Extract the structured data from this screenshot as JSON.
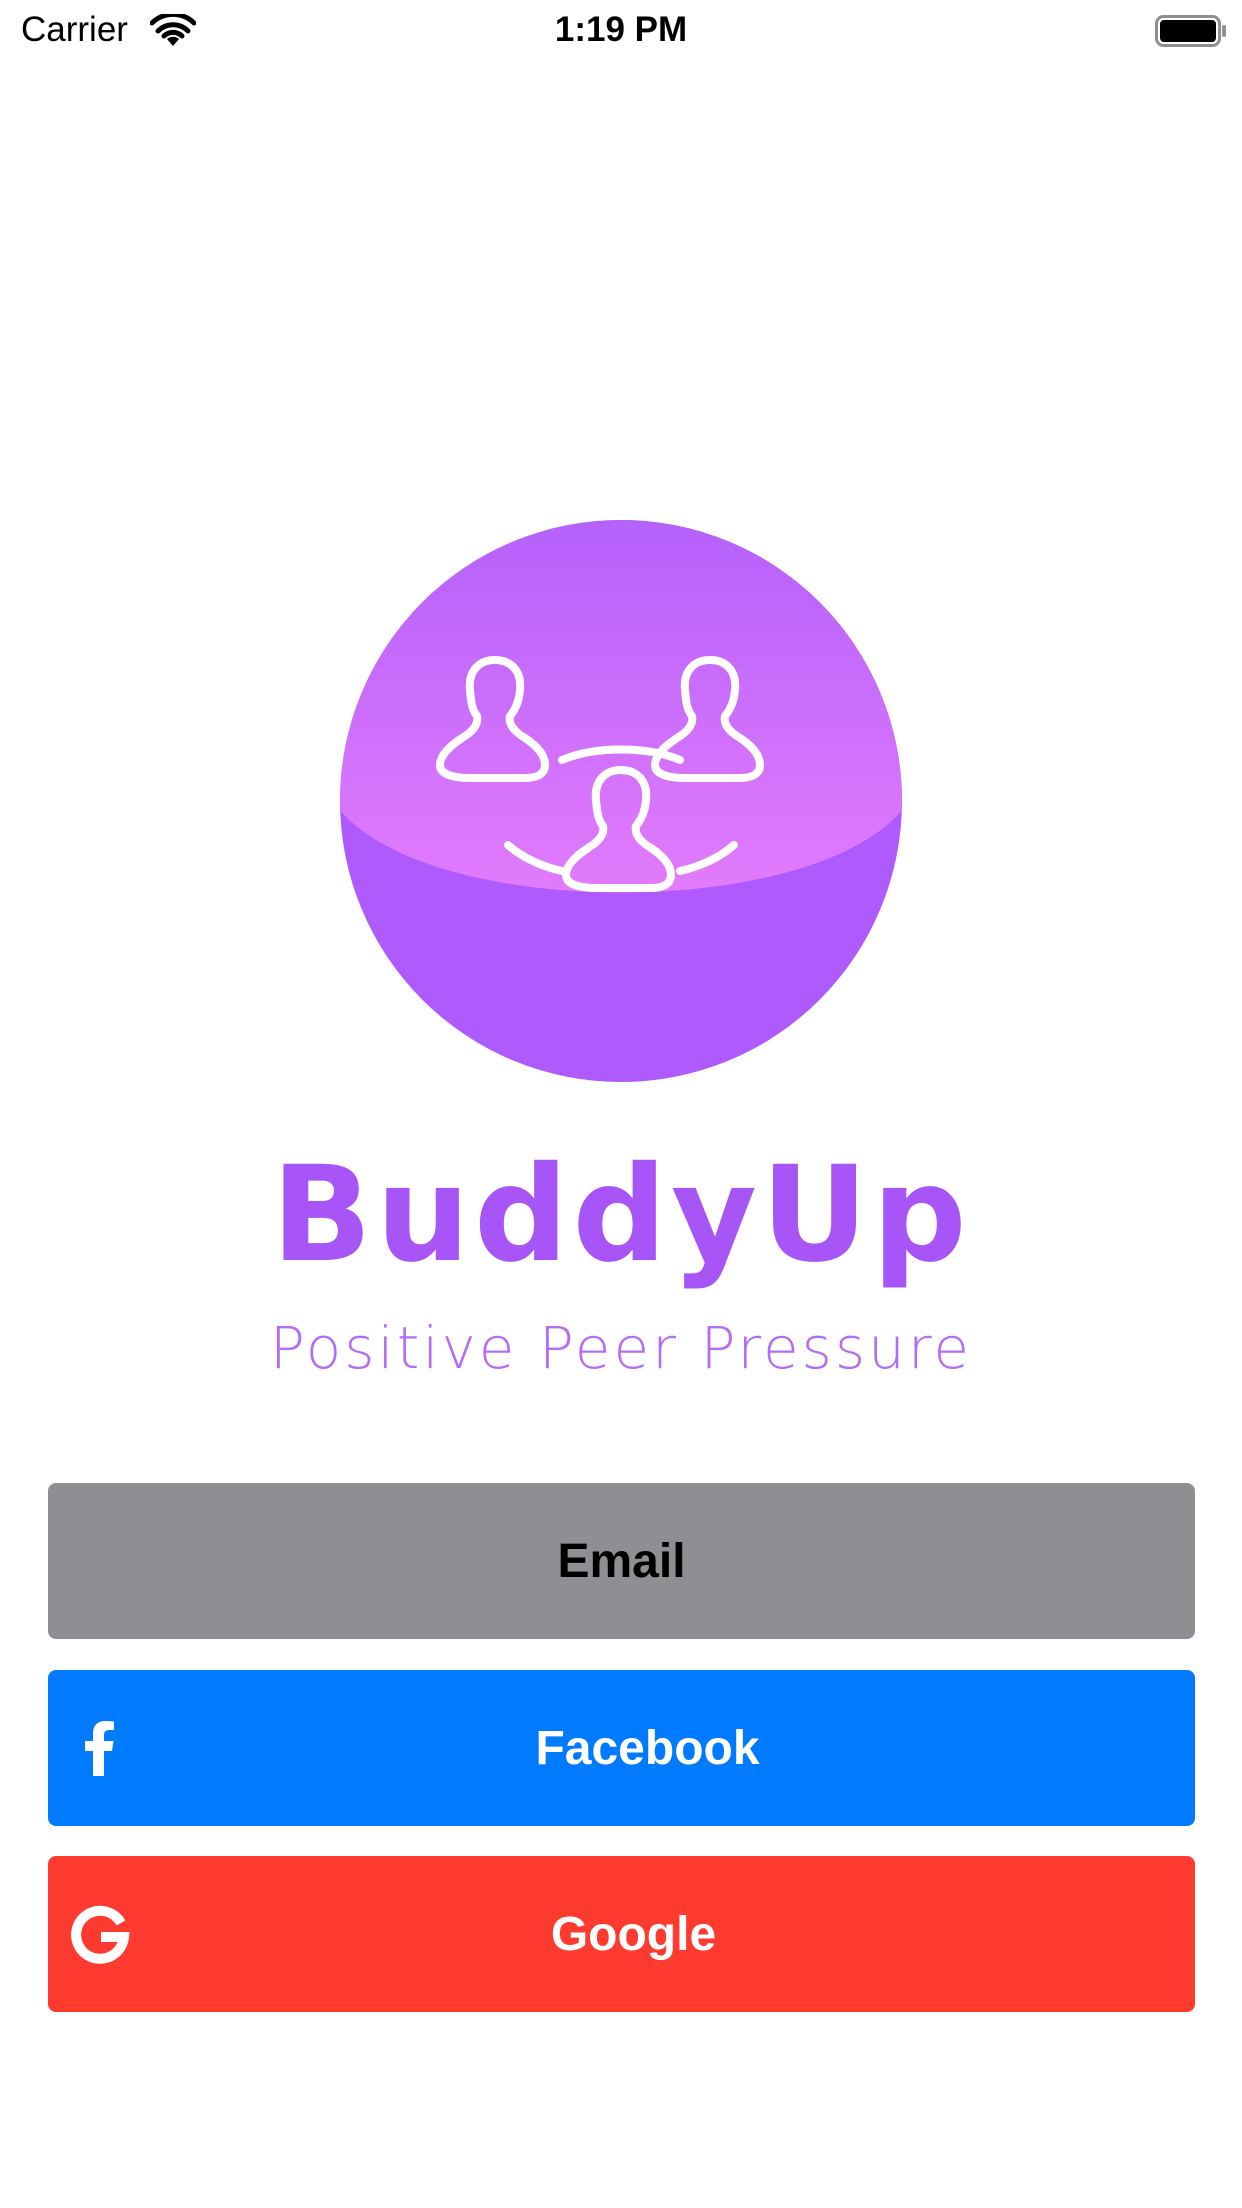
{
  "status_bar": {
    "carrier": "Carrier",
    "time": "1:19 PM"
  },
  "app": {
    "name": "BuddyUp",
    "tagline": "Positive Peer Pressure"
  },
  "buttons": {
    "email": "Email",
    "facebook": "Facebook",
    "google": "Google"
  },
  "icons": {
    "wifi": "wifi-icon",
    "battery": "battery-icon",
    "logo": "group-people-logo",
    "facebook": "facebook-icon",
    "google": "google-icon"
  },
  "colors": {
    "brand_purple": "#a855f7",
    "email_button": "#8e8e93",
    "facebook_button": "#007aff",
    "google_button": "#ff3b30"
  }
}
